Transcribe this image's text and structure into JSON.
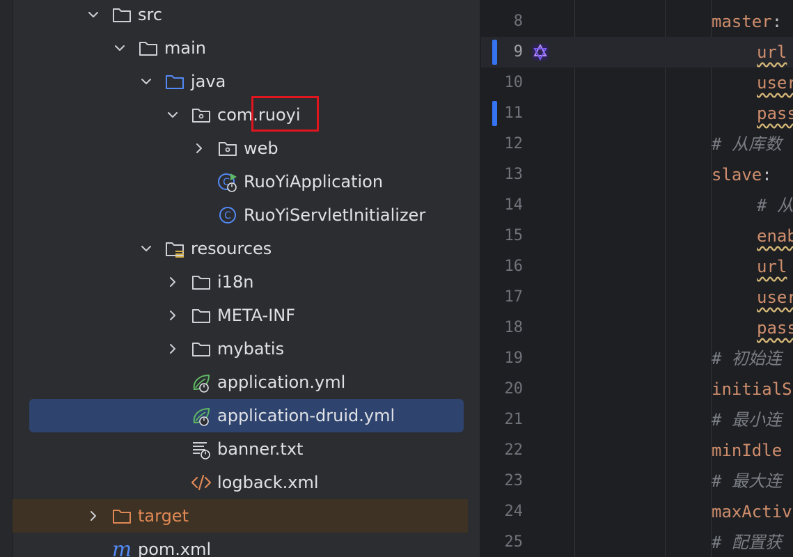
{
  "tree": {
    "items": [
      {
        "label": "src",
        "depth": 0,
        "arrow": "down",
        "icon": "folder-icon"
      },
      {
        "label": "main",
        "depth": 1,
        "arrow": "down",
        "icon": "folder-icon"
      },
      {
        "label": "java",
        "depth": 2,
        "arrow": "down",
        "icon": "source-folder-icon"
      },
      {
        "label": "com.ruoyi",
        "depth": 3,
        "arrow": "down",
        "icon": "package-icon"
      },
      {
        "label": "web",
        "depth": 4,
        "arrow": "right",
        "icon": "package-icon"
      },
      {
        "label": "RuoYiApplication",
        "depth": 4,
        "arrow": "none",
        "icon": "spring-boot-class-icon"
      },
      {
        "label": "RuoYiServletInitializer",
        "depth": 4,
        "arrow": "none",
        "icon": "class-icon"
      },
      {
        "label": "resources",
        "depth": 2,
        "arrow": "down",
        "icon": "resources-folder-icon"
      },
      {
        "label": "i18n",
        "depth": 3,
        "arrow": "right",
        "icon": "folder-icon"
      },
      {
        "label": "META-INF",
        "depth": 3,
        "arrow": "right",
        "icon": "folder-icon"
      },
      {
        "label": "mybatis",
        "depth": 3,
        "arrow": "right",
        "icon": "folder-icon"
      },
      {
        "label": "application.yml",
        "depth": 3,
        "arrow": "none",
        "icon": "spring-yaml-icon"
      },
      {
        "label": "application-druid.yml",
        "depth": 3,
        "arrow": "none",
        "icon": "spring-yaml-icon",
        "selected": true
      },
      {
        "label": "banner.txt",
        "depth": 3,
        "arrow": "none",
        "icon": "text-file-icon"
      },
      {
        "label": "logback.xml",
        "depth": 3,
        "arrow": "none",
        "icon": "xml-file-icon"
      },
      {
        "label": "target",
        "depth": 0,
        "arrow": "right",
        "icon": "excluded-folder-icon",
        "excluded": true
      },
      {
        "label": "pom.xml",
        "depth": 0,
        "arrow": "none",
        "icon": "maven-icon"
      }
    ]
  },
  "editor": {
    "lines": [
      {
        "num": "8",
        "indent": 0,
        "tokens": [
          {
            "t": "master",
            "c": "k"
          },
          {
            "t": ":",
            "c": "p"
          }
        ]
      },
      {
        "num": "9",
        "indent": 1,
        "current": true,
        "mark": true,
        "ai": true,
        "tokens": [
          {
            "t": "url",
            "c": "k sq"
          }
        ]
      },
      {
        "num": "10",
        "indent": 1,
        "tokens": [
          {
            "t": "user",
            "c": "k sq"
          }
        ]
      },
      {
        "num": "11",
        "indent": 1,
        "mark": true,
        "tokens": [
          {
            "t": "pass",
            "c": "k sq"
          }
        ]
      },
      {
        "num": "12",
        "indent": 0,
        "tokens": [
          {
            "t": "# 从库数",
            "c": "c"
          }
        ]
      },
      {
        "num": "13",
        "indent": 0,
        "tokens": [
          {
            "t": "slave",
            "c": "k"
          },
          {
            "t": ":",
            "c": "p"
          }
        ]
      },
      {
        "num": "14",
        "indent": 1,
        "tokens": [
          {
            "t": "# 从",
            "c": "c"
          }
        ]
      },
      {
        "num": "15",
        "indent": 1,
        "tokens": [
          {
            "t": "enab",
            "c": "k sq"
          }
        ]
      },
      {
        "num": "16",
        "indent": 1,
        "tokens": [
          {
            "t": "url",
            "c": "k sq"
          }
        ]
      },
      {
        "num": "17",
        "indent": 1,
        "tokens": [
          {
            "t": "user",
            "c": "k sq"
          }
        ]
      },
      {
        "num": "18",
        "indent": 1,
        "tokens": [
          {
            "t": "pass",
            "c": "k sq"
          }
        ]
      },
      {
        "num": "19",
        "indent": 0,
        "tokens": [
          {
            "t": "# 初始连",
            "c": "c"
          }
        ]
      },
      {
        "num": "20",
        "indent": 0,
        "tokens": [
          {
            "t": "initialS",
            "c": "k"
          }
        ]
      },
      {
        "num": "21",
        "indent": 0,
        "tokens": [
          {
            "t": "# 最小连",
            "c": "c"
          }
        ]
      },
      {
        "num": "22",
        "indent": 0,
        "tokens": [
          {
            "t": "minIdle",
            "c": "k"
          }
        ]
      },
      {
        "num": "23",
        "indent": 0,
        "tokens": [
          {
            "t": "# 最大连",
            "c": "c"
          }
        ]
      },
      {
        "num": "24",
        "indent": 0,
        "tokens": [
          {
            "t": "maxActiv",
            "c": "k"
          }
        ]
      },
      {
        "num": "25",
        "indent": 0,
        "tokens": [
          {
            "t": "# 配置获",
            "c": "c"
          }
        ]
      }
    ]
  }
}
